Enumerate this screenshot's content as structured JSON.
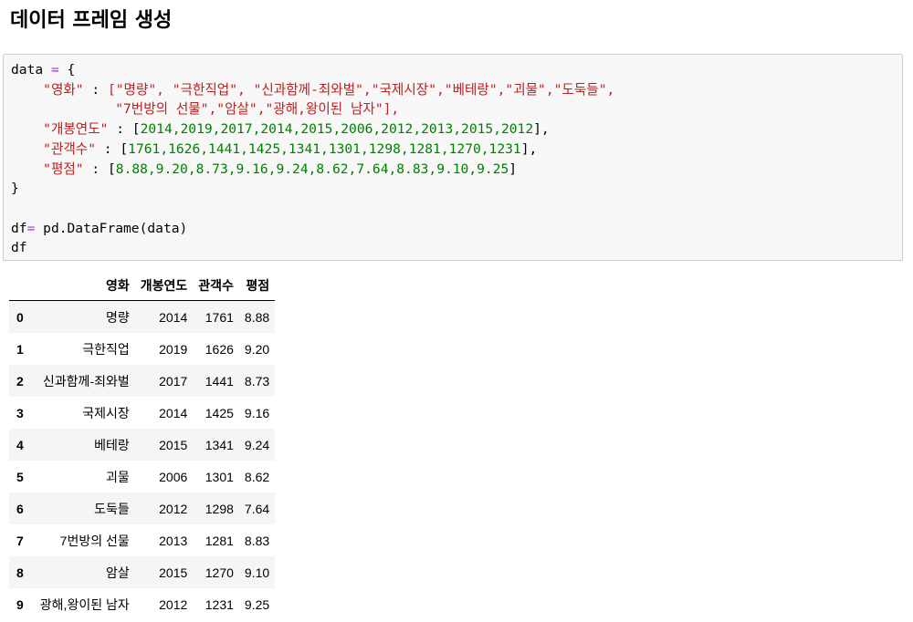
{
  "page": {
    "title": "데이터 프레임 생성"
  },
  "code": {
    "line1_var": "data",
    "line1_op": " = ",
    "line1_brace": "{",
    "key_movie": "\"영화\"",
    "movie_values_line1": "[\"명량\", \"극한직업\", \"신과함께-죄와벌\",\"국제시장\",\"베테랑\",\"괴물\",\"도둑들\",",
    "movie_values_line2": "\"7번방의 선물\",\"암살\",\"광해,왕이된 남자\"],",
    "key_year": "\"개봉연도\"",
    "year_values": "2014,2019,2017,2014,2015,2006,2012,2013,2015,2012",
    "key_audience": "\"관객수\"",
    "audience_values": "1761,1626,1441,1425,1341,1301,1298,1281,1270,1231",
    "key_rating": "\"평점\"",
    "rating_values": "8.88,9.20,8.73,9.16,9.24,8.62,7.64,8.83,9.10,9.25",
    "close_brace": "}",
    "df_line_var": "df",
    "df_line_op": "= ",
    "df_line_call": "pd.DataFrame(data)",
    "last_line": "df"
  },
  "table": {
    "headers": [
      "",
      "영화",
      "개봉연도",
      "관객수",
      "평점"
    ],
    "rows": [
      {
        "index": "0",
        "movie": "명량",
        "year": "2014",
        "audience": "1761",
        "rating": "8.88"
      },
      {
        "index": "1",
        "movie": "극한직업",
        "year": "2019",
        "audience": "1626",
        "rating": "9.20"
      },
      {
        "index": "2",
        "movie": "신과함께-죄와벌",
        "year": "2017",
        "audience": "1441",
        "rating": "8.73"
      },
      {
        "index": "3",
        "movie": "국제시장",
        "year": "2014",
        "audience": "1425",
        "rating": "9.16"
      },
      {
        "index": "4",
        "movie": "베테랑",
        "year": "2015",
        "audience": "1341",
        "rating": "9.24"
      },
      {
        "index": "5",
        "movie": "괴물",
        "year": "2006",
        "audience": "1301",
        "rating": "8.62"
      },
      {
        "index": "6",
        "movie": "도둑들",
        "year": "2012",
        "audience": "1298",
        "rating": "7.64"
      },
      {
        "index": "7",
        "movie": "7번방의 선물",
        "year": "2013",
        "audience": "1281",
        "rating": "8.83"
      },
      {
        "index": "8",
        "movie": "암살",
        "year": "2015",
        "audience": "1270",
        "rating": "9.10"
      },
      {
        "index": "9",
        "movie": "광해,왕이된 남자",
        "year": "2012",
        "audience": "1231",
        "rating": "9.25"
      }
    ]
  },
  "colors": {
    "string": "#ba2121",
    "number": "#008000",
    "operator": "#aa22ff",
    "cell_background": "#f7f7f7"
  }
}
